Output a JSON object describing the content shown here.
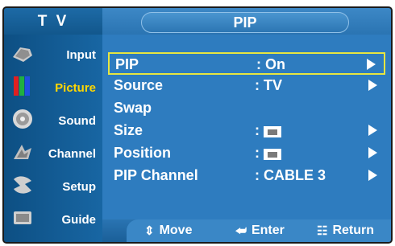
{
  "header": {
    "left_title": "T V",
    "right_title": "PIP"
  },
  "sidebar": {
    "items": [
      {
        "label": "Input",
        "icon": "input-icon"
      },
      {
        "label": "Picture",
        "icon": "picture-icon",
        "active": true
      },
      {
        "label": "Sound",
        "icon": "sound-icon"
      },
      {
        "label": "Channel",
        "icon": "channel-icon"
      },
      {
        "label": "Setup",
        "icon": "setup-icon"
      },
      {
        "label": "Guide",
        "icon": "guide-icon"
      }
    ]
  },
  "menu": {
    "rows": [
      {
        "name": "PIP",
        "value": ": On",
        "arrow": true,
        "selected": true
      },
      {
        "name": "Source",
        "value": ": TV",
        "arrow": true
      },
      {
        "name": "Swap",
        "value": "",
        "arrow": false
      },
      {
        "name": "Size",
        "value": ":",
        "arrow": true,
        "icon": "pip-size-icon"
      },
      {
        "name": "Position",
        "value": ":",
        "arrow": true,
        "icon": "pip-position-icon"
      },
      {
        "name": "PIP Channel",
        "value": ": CABLE 3",
        "arrow": true
      }
    ]
  },
  "footer": {
    "move": "Move",
    "enter": "Enter",
    "return": "Return"
  },
  "colors": {
    "panel": "#2e7cbf",
    "sidebar": "#16609b",
    "highlight": "#e7e640",
    "active_label": "#ffd700"
  }
}
